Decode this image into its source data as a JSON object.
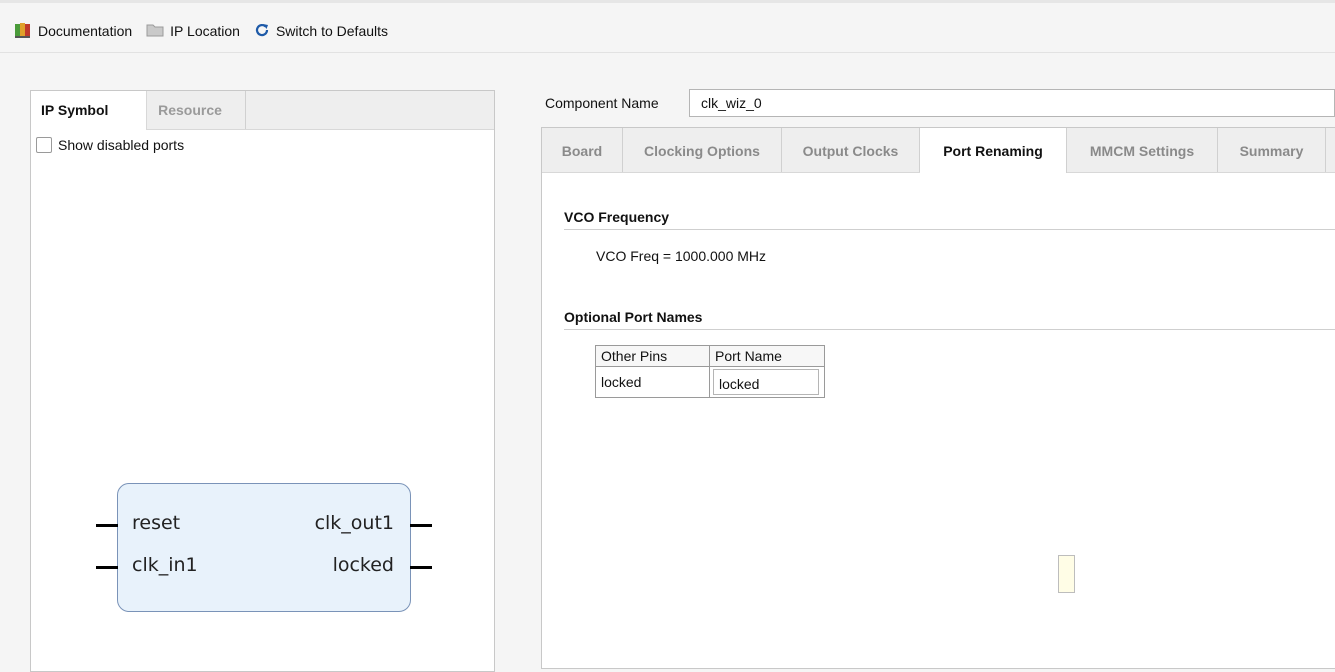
{
  "toolbar": {
    "documentation_label": "Documentation",
    "ip_location_label": "IP Location",
    "switch_defaults_label": "Switch to Defaults"
  },
  "left_panel": {
    "tabs": [
      {
        "label": "IP Symbol",
        "active": true
      },
      {
        "label": "Resource",
        "active": false
      }
    ],
    "show_disabled_ports_label": "Show disabled ports",
    "ip_symbol": {
      "left_pins": [
        "reset",
        "clk_in1"
      ],
      "right_pins": [
        "clk_out1",
        "locked"
      ]
    }
  },
  "component": {
    "label": "Component Name",
    "value": "clk_wiz_0"
  },
  "right_panel": {
    "tabs": [
      {
        "label": "Board"
      },
      {
        "label": "Clocking Options"
      },
      {
        "label": "Output Clocks"
      },
      {
        "label": "Port Renaming",
        "active": true
      },
      {
        "label": "MMCM Settings"
      },
      {
        "label": "Summary"
      }
    ],
    "vco_section_title": "VCO Frequency",
    "vco_text": "VCO Freq = 1000.000 MHz",
    "optional_section_title": "Optional Port Names",
    "port_table": {
      "headers": [
        "Other Pins",
        "Port Name"
      ],
      "rows": [
        {
          "pin": "locked",
          "port_name": "locked"
        }
      ]
    }
  },
  "colors": {
    "symbol_fill": "#e8f2fb",
    "symbol_border": "#7a93b8",
    "tab_inactive_text": "#8a8a8a"
  }
}
